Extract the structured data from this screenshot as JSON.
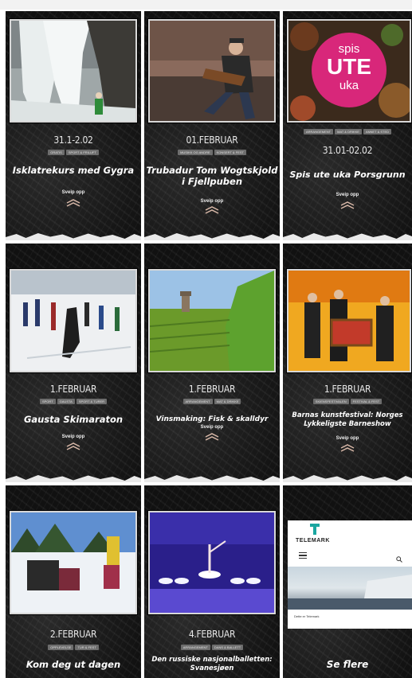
{
  "cards": [
    {
      "date": "31.1-2.02",
      "tags": [
        "GRATIS",
        "SPORT & FRILUFT"
      ],
      "title": "Isklatrekurs med Gygra",
      "swipe": "Sveip opp",
      "image": "ice-climbing-photo"
    },
    {
      "date": "01.FEBRUAR",
      "tags": [
        "MUSIKK OG ANDRE",
        "KONSERT & FEST"
      ],
      "title": "Trubadur Tom Wogtskjold i Fjellpuben",
      "swipe": "Sveip opp",
      "image": "guitarist-photo"
    },
    {
      "date": "31.01-02.02",
      "tags": [
        "ARRANGEMENT",
        "MAT & DRIKKE",
        "ANNET & STED"
      ],
      "title": "Spis ute uka Porsgrunn",
      "swipe": "Sveip opp",
      "image": "spis-ute-uka-logo",
      "logo_lines": [
        "spis",
        "UTE",
        "uka"
      ]
    },
    {
      "date": "1.FEBRUAR",
      "tags": [
        "SPORT",
        "GAUSTA",
        "SPORT & TURER"
      ],
      "title": "Gausta Skimaraton",
      "swipe": "Sveip opp",
      "image": "ski-race-photo"
    },
    {
      "date": "1.FEBRUAR",
      "tags": [
        "ARRANGEMENT",
        "MAT & DRIKKE"
      ],
      "title": "Vinsmaking: Fisk & skalldyr",
      "swipe": "Sveip opp",
      "image": "vineyard-photo"
    },
    {
      "date": "1.FEBRUAR",
      "tags": [
        "SKIENSFESTIVALEN",
        "FESTIVAL & FEST"
      ],
      "title": "Barnas kunstfestival: Norges Lykkeligste Barneshow",
      "swipe": "Sveip opp",
      "image": "performers-photo"
    },
    {
      "date": "2.FEBRUAR",
      "tags": [
        "OPPLEVELSE",
        "TUR & FEST"
      ],
      "title": "Kom deg ut dagen",
      "swipe": "",
      "image": "winter-family-photo"
    },
    {
      "date": "4.FEBRUAR",
      "tags": [
        "ARRANGEMENT",
        "DANS & BALLETT"
      ],
      "title": "Den russiske nasjonalballetten: Svanesjøen",
      "swipe": "",
      "image": "ballet-photo"
    },
    {
      "date": "",
      "tags": [],
      "title": "Se flere",
      "swipe": "",
      "image": "telemark-site-preview",
      "brand": "TELEMARK",
      "preview_caption": "Dette er Telemark"
    }
  ],
  "colors": {
    "card_bg": "#151515",
    "tag_bg": "#6d6d6d",
    "spis_pink": "#d8277a"
  }
}
